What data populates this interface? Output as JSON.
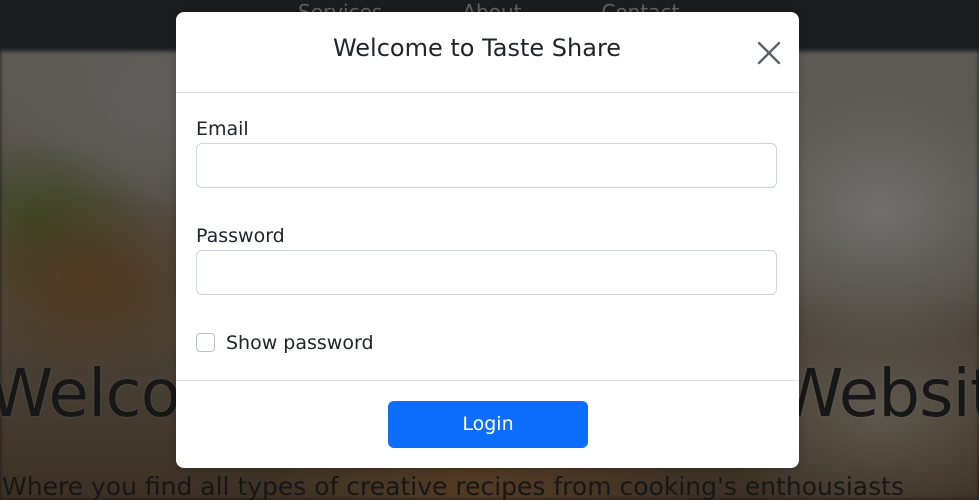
{
  "navbar": {
    "links": [
      "Services",
      "About",
      "Contact"
    ]
  },
  "hero": {
    "title": "Welcome to Taste Share Website",
    "subtitle": "Where you find all types of creative recipes from cooking's enthousiasts"
  },
  "modal": {
    "title": "Welcome to Taste Share",
    "close_icon": "close-icon",
    "email": {
      "label": "Email",
      "value": "",
      "placeholder": ""
    },
    "password": {
      "label": "Password",
      "value": "",
      "placeholder": ""
    },
    "show_password": {
      "label": "Show password",
      "checked": false
    },
    "login_label": "Login"
  },
  "colors": {
    "primary": "#0d6efd",
    "navbar": "#343a40",
    "backdrop": "rgba(0,0,0,0.5)"
  }
}
